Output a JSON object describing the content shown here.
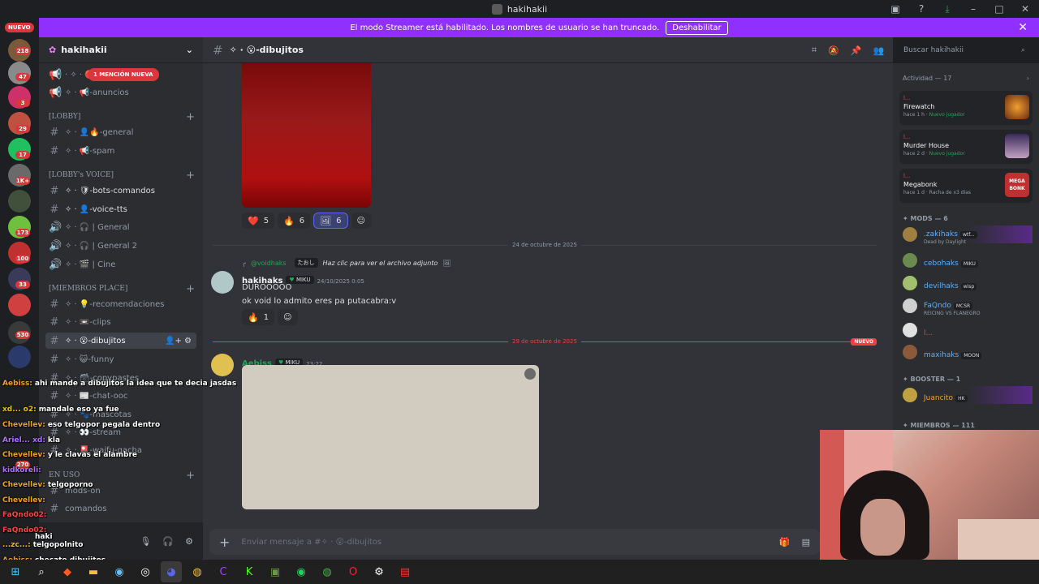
{
  "window": {
    "title": "hakihakii"
  },
  "banner": {
    "text": "El modo Streamer está habilitado. Los nombres de usuario se han truncado.",
    "button": "Deshabilitar"
  },
  "guilds": {
    "new_label": "NUEVO",
    "badges": [
      "218",
      "47",
      "3",
      "29",
      "17",
      "1K+",
      "173",
      "100",
      "33",
      "530",
      "270"
    ]
  },
  "server": {
    "name": "hakihakii",
    "mention_pill": "1 MENCIÓN NUEVA"
  },
  "channels": [
    {
      "name": "· ✧ · 🔴",
      "kind": "announce"
    },
    {
      "name": "✧ · 📢-anuncios",
      "kind": "announce"
    },
    {
      "name": "[LOBBY]",
      "kind": "category"
    },
    {
      "name": "✧ · 👤🔥-general",
      "kind": "text"
    },
    {
      "name": "✧ · 📢-spam",
      "kind": "text"
    },
    {
      "name": "[LOBBY's VOICE]",
      "kind": "category"
    },
    {
      "name": "✧ · 🛡-bots-comandos",
      "kind": "text"
    },
    {
      "name": "✧ · 👤-voice-tts",
      "kind": "text"
    },
    {
      "name": "✧ · 🎧 | General",
      "kind": "voice"
    },
    {
      "name": "✧ · 🎧 | General 2",
      "kind": "voice"
    },
    {
      "name": "✧ · 🎬 | Cine",
      "kind": "voice"
    },
    {
      "name": "[MIEMBROS PLACE]",
      "kind": "category"
    },
    {
      "name": "✧ · 💡-recomendaciones",
      "kind": "text"
    },
    {
      "name": "✧ · 📼-clips",
      "kind": "text"
    },
    {
      "name": "✧ · 😮-dibujitos",
      "kind": "text"
    },
    {
      "name": "✧ · 😺-funny",
      "kind": "text"
    },
    {
      "name": "✧ · 🗃-copypastes",
      "kind": "text"
    },
    {
      "name": "✧ · 📰-chat-ooc",
      "kind": "text"
    },
    {
      "name": "✧ · 🐾-mascotas",
      "kind": "text"
    },
    {
      "name": "✧ · 👀-stream",
      "kind": "text"
    },
    {
      "name": "✧ · 🎴-waifu-gacha",
      "kind": "text"
    },
    {
      "name": "EN USO",
      "kind": "category"
    },
    {
      "name": "mods-on",
      "kind": "text"
    },
    {
      "name": "comandos",
      "kind": "text"
    }
  ],
  "chat": {
    "channel": "✧ · 😮-dibujitos",
    "search_placeholder": "Buscar hakihakii",
    "reactions1": [
      {
        "emoji": "❤️",
        "count": "5"
      },
      {
        "emoji": "🔥",
        "count": "6"
      },
      {
        "emoji": "🖼",
        "count": "6"
      }
    ],
    "date1": "24 de octubre de 2025",
    "reply": {
      "user": "@voidhaks",
      "badge": "たおし",
      "text": "Haz clic para ver el archivo adjunto"
    },
    "msg1": {
      "user": "hakihaks",
      "badge": "MIKU",
      "time": "24/10/2025 0:05",
      "lines": [
        "DUROOOOO",
        "ok void lo admito eres pa putacabra:v"
      ]
    },
    "reactions2": [
      {
        "emoji": "🔥",
        "count": "1"
      }
    ],
    "date2": "29 de octubre de 2025",
    "new_tag": "NUEVO",
    "msg2": {
      "user": "Aebiss",
      "badge": "MIKU",
      "time": "23:22"
    },
    "composer_placeholder": "Enviar mensaje a #✧ · 😮-dibujitos"
  },
  "activity": {
    "header": "Actividad — 17",
    "cards": [
      {
        "who": "l...",
        "game": "Firewatch",
        "time": "hace 1 h",
        "tag": "Nuevo jugador"
      },
      {
        "who": "l...",
        "game": "Murder House",
        "time": "hace 2 d",
        "tag": "Nuevo jugador"
      },
      {
        "who": "l...",
        "game": "Megabonk",
        "time": "hace 1 d",
        "tag": "Racha de x3 días",
        "art_text": "MEGA BONK"
      }
    ],
    "mods_header": "✦ MODS — 6",
    "mods": [
      {
        "name": ".zakihaks",
        "badge": "wtf...",
        "status": "Dead by Daylight",
        "color": "#5ab0ff"
      },
      {
        "name": "cebohaks",
        "badge": "MIKU",
        "status": "",
        "color": "#5ab0ff"
      },
      {
        "name": "devilhaks",
        "badge": "wisp",
        "status": "",
        "color": "#5ab0ff"
      },
      {
        "name": "FaQndo",
        "badge": "MCSR",
        "status": "REICING VS FLANEGRO",
        "color": "#5ab0ff"
      },
      {
        "name": "l...",
        "badge": "",
        "status": "",
        "color": "#f23f42"
      },
      {
        "name": "maxihaks",
        "badge": "MOON",
        "status": "",
        "color": "#5ab0ff"
      }
    ],
    "booster_header": "✦ BOOSTER — 1",
    "booster": {
      "name": "Juancito",
      "badge": "HK",
      "color": "#f0a030"
    },
    "members_header": "✦ MIEMBROS — 111"
  },
  "overlay_chat": [
    {
      "user": "Aebiss:",
      "text": "ahi mande a dibujitos la idea que te decia jasdas",
      "color": "#f0a020"
    },
    {
      "user": "xd... o2:",
      "text": "mandale eso ya fue",
      "color": "#f0c000"
    },
    {
      "user": "Chevellev:",
      "text": "eso telgopor pegala dentro",
      "color": "#f0a020"
    },
    {
      "user": "Ariel... xd:",
      "text": "kla",
      "color": "#b070ff"
    },
    {
      "user": "Chevellev:",
      "text": "y le clavas el alambre",
      "color": "#f0a020"
    },
    {
      "user": "kidkoreli:",
      "text": "",
      "color": "#b070ff"
    },
    {
      "user": "Chevellev:",
      "text": "telgoporno",
      "color": "#f0a020"
    },
    {
      "user": "Chevellev:",
      "text": "",
      "color": "#f0a020"
    },
    {
      "user": "FaQndo02:",
      "text": "",
      "color": "#ff4040"
    },
    {
      "user": "FaQndo02:",
      "text": "",
      "color": "#ff4040"
    },
    {
      "user": "",
      "text": "haki",
      "color": "#ffffff"
    },
    {
      "user": "...zc...:",
      "text": "telgopolnito",
      "color": "#f0c000"
    },
    {
      "user": "Aebiss:",
      "text": "checate dibujitos",
      "color": "#f0a020"
    }
  ],
  "colors": {
    "accent": "#8f30ff",
    "mention": "#da373c",
    "bg": "#313338",
    "sidebar": "#2b2d31"
  }
}
